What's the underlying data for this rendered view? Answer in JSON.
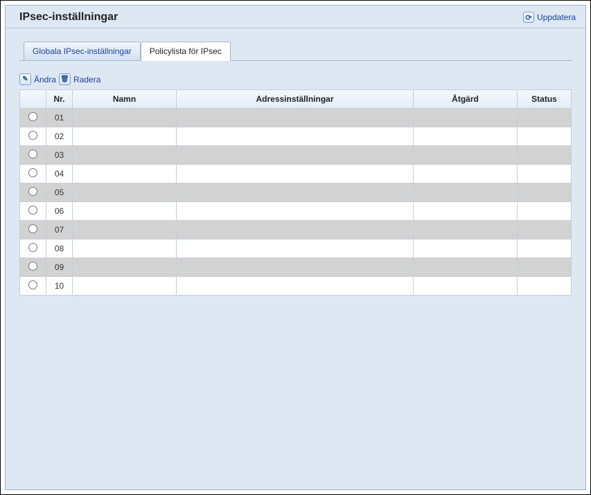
{
  "header": {
    "title": "IPsec-inställningar",
    "update_label": "Uppdatera"
  },
  "tabs": {
    "global": "Globala IPsec-inställningar",
    "policy": "Policylista för IPsec"
  },
  "toolbar": {
    "edit_label": "Ändra",
    "delete_label": "Radera"
  },
  "table": {
    "columns": {
      "nr": "Nr.",
      "name": "Namn",
      "address": "Adressinställningar",
      "action": "Åtgärd",
      "status": "Status"
    },
    "rows": [
      {
        "nr": "01",
        "name": "",
        "address": "",
        "action": "",
        "status": ""
      },
      {
        "nr": "02",
        "name": "",
        "address": "",
        "action": "",
        "status": ""
      },
      {
        "nr": "03",
        "name": "",
        "address": "",
        "action": "",
        "status": ""
      },
      {
        "nr": "04",
        "name": "",
        "address": "",
        "action": "",
        "status": ""
      },
      {
        "nr": "05",
        "name": "",
        "address": "",
        "action": "",
        "status": ""
      },
      {
        "nr": "06",
        "name": "",
        "address": "",
        "action": "",
        "status": ""
      },
      {
        "nr": "07",
        "name": "",
        "address": "",
        "action": "",
        "status": ""
      },
      {
        "nr": "08",
        "name": "",
        "address": "",
        "action": "",
        "status": ""
      },
      {
        "nr": "09",
        "name": "",
        "address": "",
        "action": "",
        "status": ""
      },
      {
        "nr": "10",
        "name": "",
        "address": "",
        "action": "",
        "status": ""
      }
    ]
  }
}
